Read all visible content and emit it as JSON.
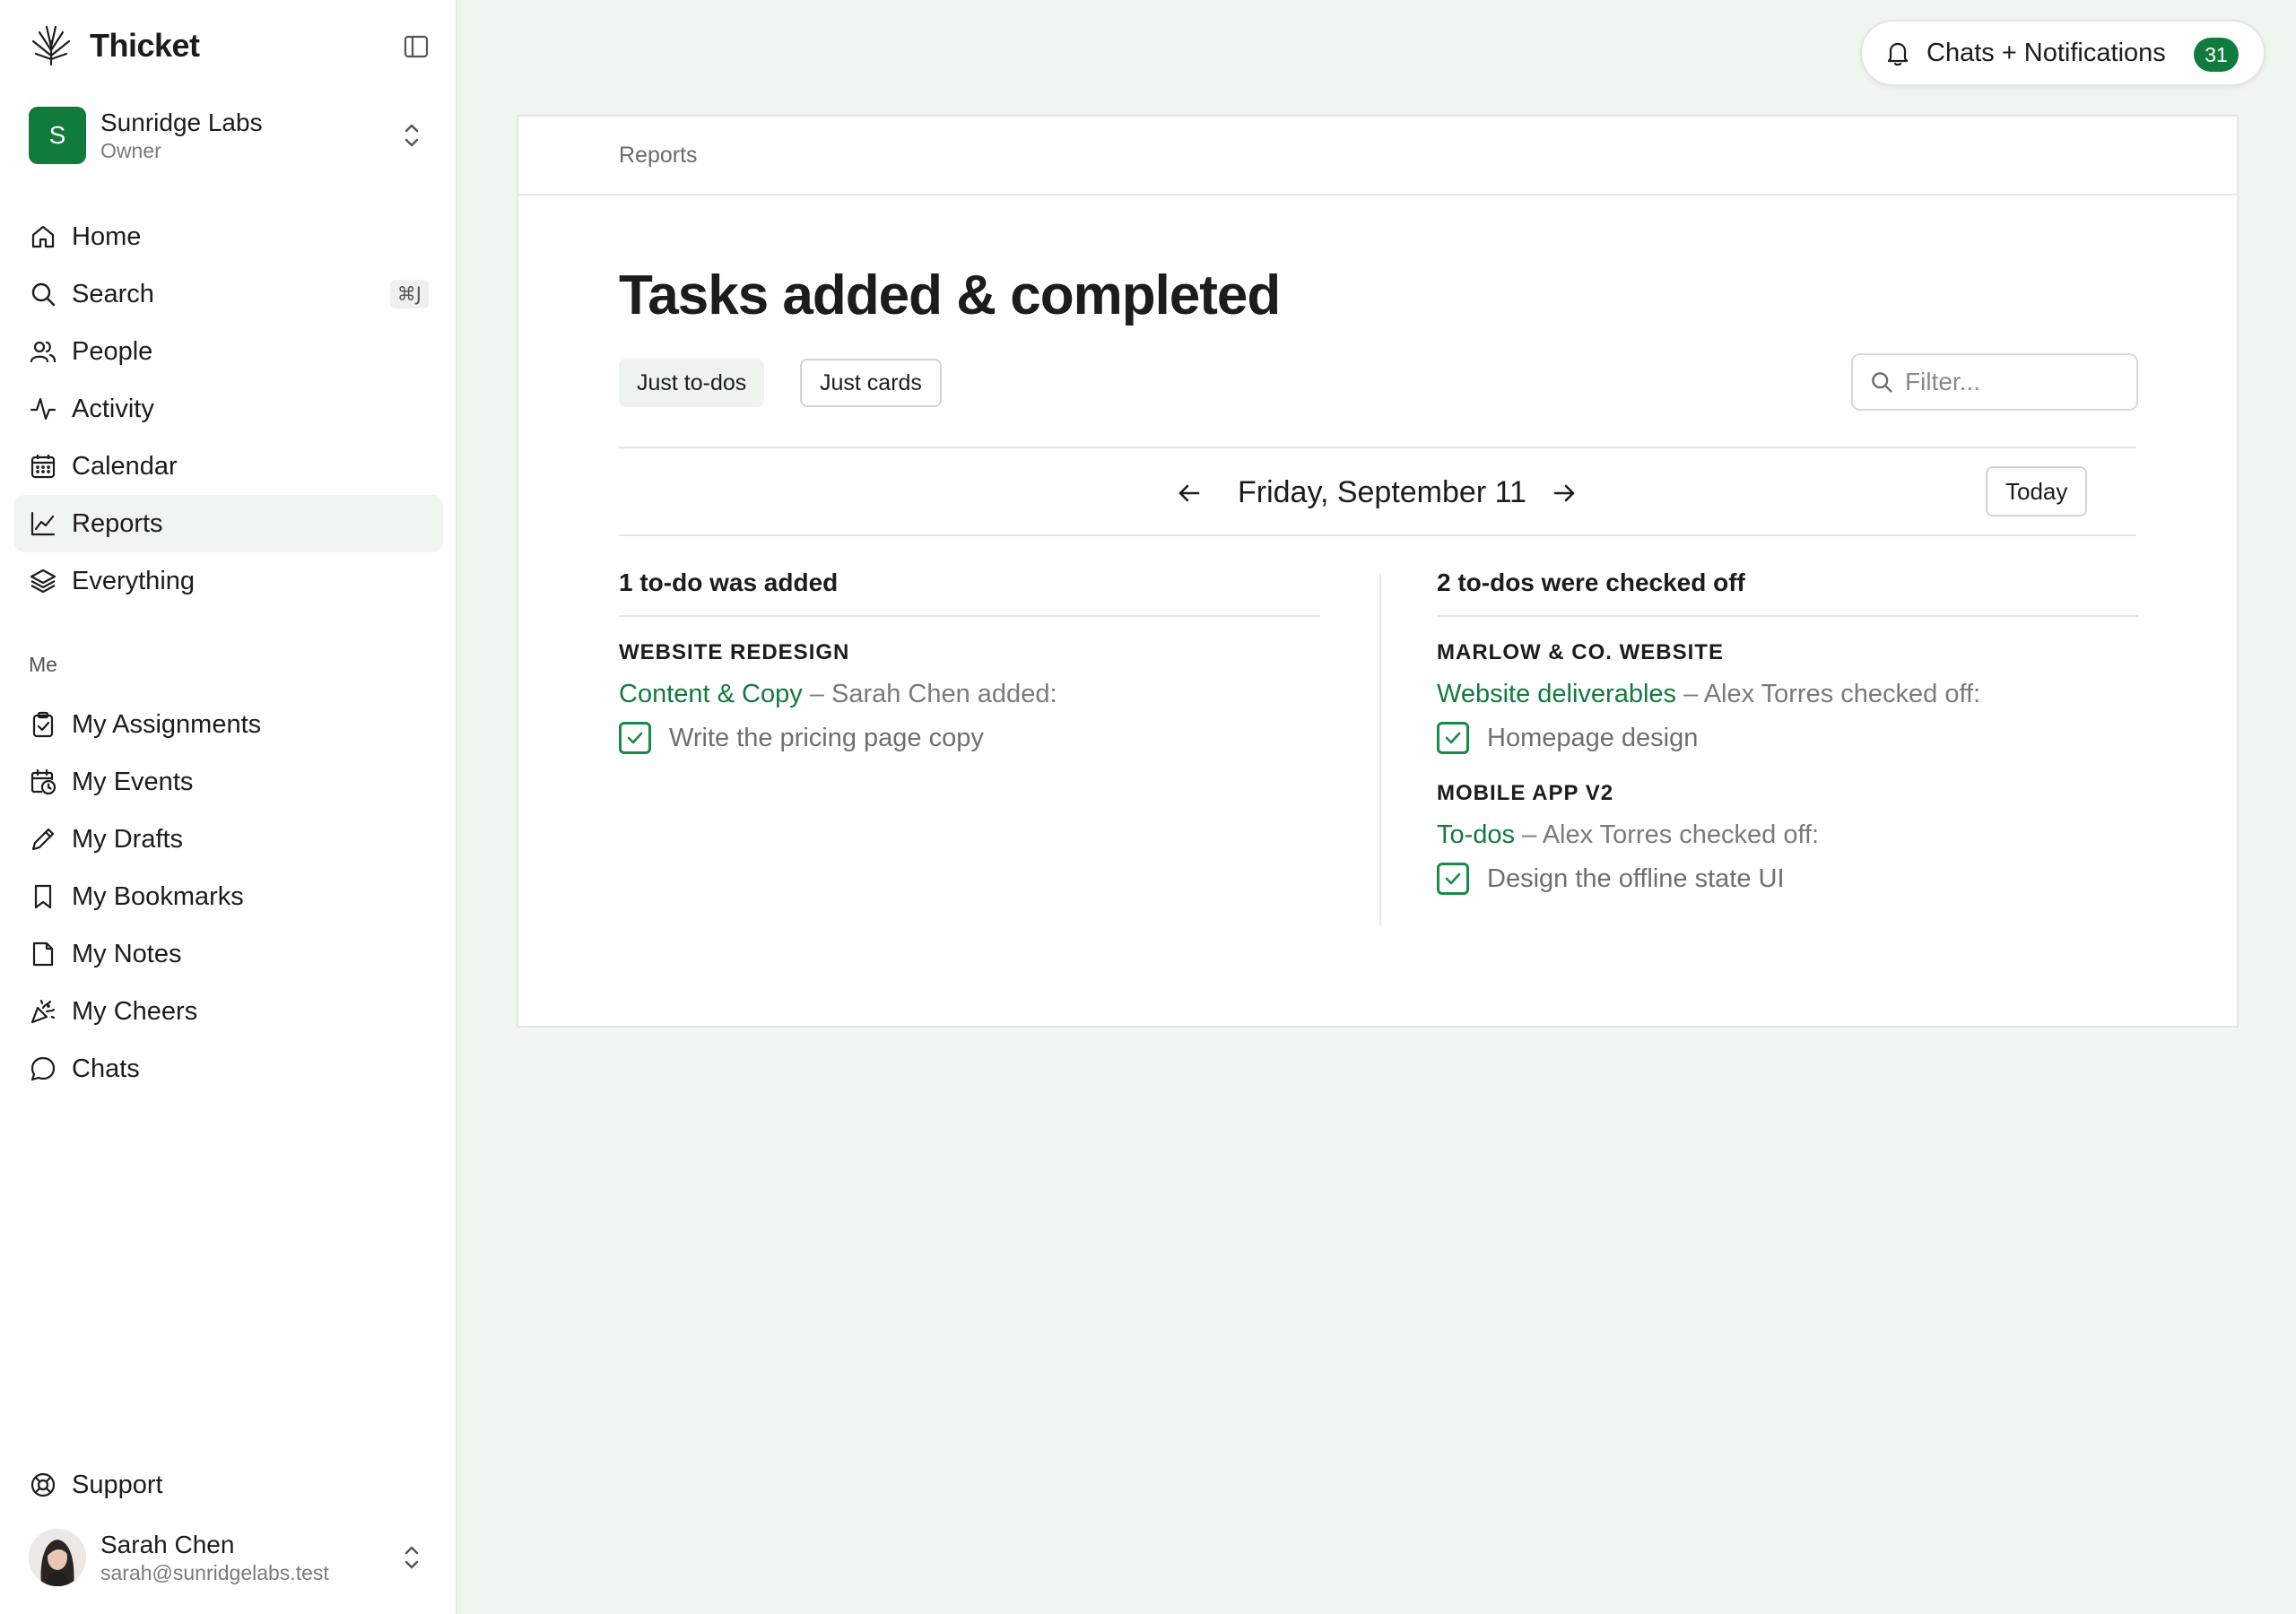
{
  "app": {
    "name": "Thicket"
  },
  "workspace": {
    "initial": "S",
    "name": "Sunridge Labs",
    "role": "Owner"
  },
  "nav": [
    {
      "label": "Home",
      "icon": "home-icon"
    },
    {
      "label": "Search",
      "icon": "search-icon",
      "shortcut": "⌘J"
    },
    {
      "label": "People",
      "icon": "people-icon"
    },
    {
      "label": "Activity",
      "icon": "activity-icon"
    },
    {
      "label": "Calendar",
      "icon": "calendar-icon"
    },
    {
      "label": "Reports",
      "icon": "chart-icon",
      "active": true
    },
    {
      "label": "Everything",
      "icon": "layers-icon"
    }
  ],
  "me_section": {
    "label": "Me",
    "items": [
      {
        "label": "My Assignments",
        "icon": "clipboard-icon"
      },
      {
        "label": "My Events",
        "icon": "calendar-clock-icon"
      },
      {
        "label": "My Drafts",
        "icon": "pencil-icon"
      },
      {
        "label": "My Bookmarks",
        "icon": "bookmark-icon"
      },
      {
        "label": "My Notes",
        "icon": "note-icon"
      },
      {
        "label": "My Cheers",
        "icon": "party-popper-icon"
      },
      {
        "label": "Chats",
        "icon": "chat-bubble-icon"
      }
    ]
  },
  "support": {
    "label": "Support",
    "icon": "lifebuoy-icon"
  },
  "user": {
    "name": "Sarah Chen",
    "email": "sarah@sunridgelabs.test"
  },
  "notifications": {
    "label": "Chats + Notifications",
    "count": "31"
  },
  "breadcrumb": "Reports",
  "page_title": "Tasks added & completed",
  "filters": {
    "chip1": "Just to-dos",
    "chip2": "Just cards",
    "placeholder": "Filter..."
  },
  "date": {
    "label": "Friday, September 11",
    "today_label": "Today"
  },
  "added": {
    "heading": "1 to-do was added",
    "groups": [
      {
        "project": "WEBSITE REDESIGN",
        "list": "Content & Copy",
        "action": " – Sarah Chen added:",
        "todos": [
          "Write the pricing page copy"
        ]
      }
    ]
  },
  "completed": {
    "heading": "2 to-dos were checked off",
    "groups": [
      {
        "project": "MARLOW & CO. WEBSITE",
        "list": "Website deliverables",
        "action": " – Alex Torres checked off:",
        "todos": [
          "Homepage design"
        ]
      },
      {
        "project": "MOBILE APP V2",
        "list": "To-dos",
        "action": " – Alex Torres checked off:",
        "todos": [
          "Design the offline state UI"
        ]
      }
    ]
  },
  "colors": {
    "accent": "#117a3d",
    "background": "#eff5ef"
  }
}
